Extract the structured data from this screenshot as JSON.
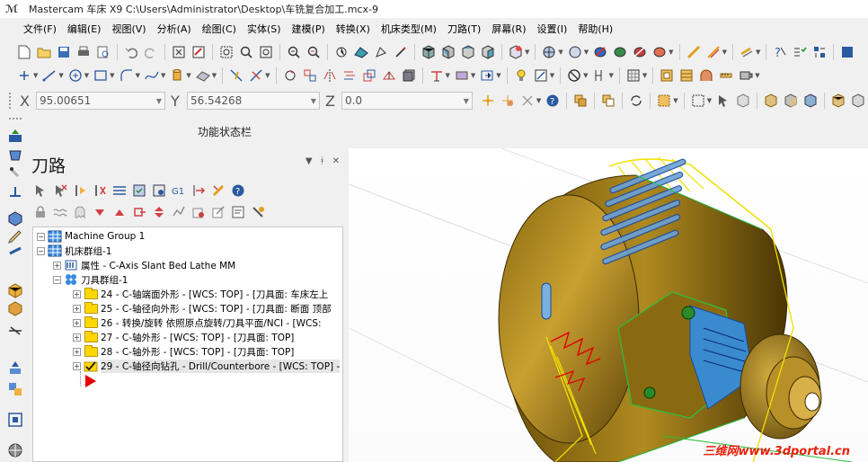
{
  "window": {
    "title": "Mastercam 车床 X9  C:\\Users\\Administrator\\Desktop\\车铣复合加工.mcx-9"
  },
  "menu": [
    "文件(F)",
    "编辑(E)",
    "视图(V)",
    "分析(A)",
    "绘图(C)",
    "实体(S)",
    "建模(P)",
    "转换(X)",
    "机床类型(M)",
    "刀路(T)",
    "屏幕(R)",
    "设置(I)",
    "帮助(H)"
  ],
  "coords": {
    "x_label": "X",
    "x_value": "95.00651",
    "y_label": "Y",
    "y_value": "56.54268",
    "z_label": "Z",
    "z_value": "0.0"
  },
  "function_bar": {
    "label": "功能状态栏"
  },
  "panel": {
    "title": "刀路",
    "tree": [
      {
        "label": "Machine Group 1"
      },
      {
        "label": "机床群组-1"
      },
      {
        "label": "属性 - C-Axis Slant Bed Lathe MM"
      },
      {
        "label": "刀具群组-1"
      },
      {
        "label": "24 - C-轴端面外形 - [WCS: TOP] - [刀具面: 车床左上"
      },
      {
        "label": "25 - C-轴径向外形 - [WCS: TOP] - [刀具面: 断面 顶部"
      },
      {
        "label": "26 - 转换/旋转 依照原点旋转/刀具平面/NCI - [WCS:"
      },
      {
        "label": "27 - C-轴外形 - [WCS: TOP] - [刀具面: TOP]"
      },
      {
        "label": "28 - C-轴外形 - [WCS: TOP] - [刀具面: TOP]"
      },
      {
        "label": "29 - C-轴径向钻孔 - Drill/Counterbore - [WCS: TOP] -"
      }
    ]
  },
  "watermark": "三维网www.3dportal.cn"
}
